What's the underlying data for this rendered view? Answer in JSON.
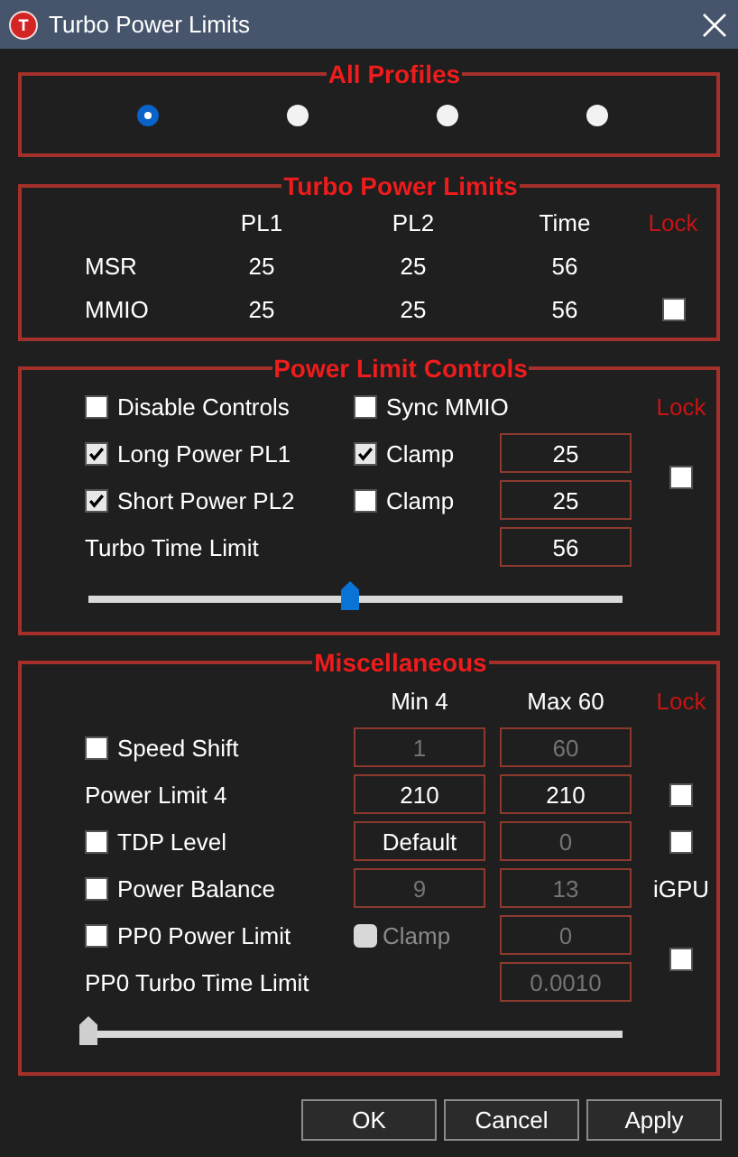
{
  "window": {
    "title": "Turbo Power Limits",
    "icon_letter": "T"
  },
  "all_profiles": {
    "title": "All Profiles",
    "profiles": [
      {
        "selected": true
      },
      {
        "selected": false
      },
      {
        "selected": false
      },
      {
        "selected": false
      }
    ]
  },
  "turbo_power_limits": {
    "title": "Turbo Power Limits",
    "columns": [
      "PL1",
      "PL2",
      "Time"
    ],
    "lock_label": "Lock",
    "rows": [
      {
        "label": "MSR",
        "values": [
          "25",
          "25",
          "56"
        ]
      },
      {
        "label": "MMIO",
        "values": [
          "25",
          "25",
          "56"
        ],
        "lock": {
          "checked": false
        }
      }
    ]
  },
  "power_limit_controls": {
    "title": "Power Limit Controls",
    "rows": [
      {
        "cells": [
          {
            "kind": "checkbox",
            "label": "Disable Controls",
            "checked": false
          },
          {
            "kind": "checkbox",
            "label": "Sync MMIO",
            "checked": false
          },
          {
            "kind": "empty"
          }
        ],
        "side": {
          "kind": "heading",
          "label": "Lock"
        }
      },
      {
        "cells": [
          {
            "kind": "checkbox",
            "label": "Long Power PL1",
            "checked": true
          },
          {
            "kind": "checkbox",
            "label": "Clamp",
            "checked": true
          },
          {
            "kind": "field",
            "value": "25",
            "disabled": false
          }
        ],
        "side": {
          "kind": "tall_checkbox",
          "checked": false
        }
      },
      {
        "cells": [
          {
            "kind": "checkbox",
            "label": "Short Power PL2",
            "checked": true
          },
          {
            "kind": "checkbox",
            "label": "Clamp",
            "checked": false
          },
          {
            "kind": "field",
            "value": "25",
            "disabled": false
          }
        ]
      },
      {
        "cells": [
          {
            "kind": "text",
            "label": "Turbo Time Limit"
          },
          {
            "kind": "empty"
          },
          {
            "kind": "field",
            "value": "56",
            "disabled": false
          }
        ]
      }
    ],
    "slider": {
      "level": 0.49,
      "disabled": false
    }
  },
  "miscellaneous": {
    "title": "Miscellaneous",
    "rows": [
      {
        "cells": [
          {
            "kind": "empty"
          },
          {
            "kind": "caption",
            "label": "Min 4"
          },
          {
            "kind": "caption",
            "label": "Max 60"
          }
        ],
        "side": {
          "kind": "heading",
          "label": "Lock"
        }
      },
      {
        "cells": [
          {
            "kind": "checkbox",
            "label": "Speed Shift",
            "checked": false
          },
          {
            "kind": "field",
            "value": "1",
            "disabled": true
          },
          {
            "kind": "field",
            "value": "60",
            "disabled": true
          }
        ]
      },
      {
        "cells": [
          {
            "kind": "text",
            "label": "Power Limit 4"
          },
          {
            "kind": "field",
            "value": "210",
            "disabled": false
          },
          {
            "kind": "field",
            "value": "210",
            "disabled": false
          }
        ],
        "side": {
          "kind": "checkbox",
          "checked": false
        }
      },
      {
        "cells": [
          {
            "kind": "checkbox",
            "label": "TDP Level",
            "checked": false
          },
          {
            "kind": "field",
            "value": "Default",
            "disabled": false
          },
          {
            "kind": "field",
            "value": "0",
            "disabled": true
          }
        ],
        "side": {
          "kind": "checkbox",
          "checked": false
        }
      },
      {
        "cells": [
          {
            "kind": "checkbox",
            "label": "Power Balance",
            "checked": false
          },
          {
            "kind": "field",
            "value": "9",
            "disabled": true
          },
          {
            "kind": "field",
            "value": "13",
            "disabled": true
          }
        ],
        "side": {
          "kind": "text",
          "label": "iGPU"
        }
      },
      {
        "cells": [
          {
            "kind": "checkbox",
            "label": "PP0 Power Limit",
            "checked": false
          },
          {
            "kind": "checkbox",
            "label": "Clamp",
            "checked": false,
            "disabled": true
          },
          {
            "kind": "field",
            "value": "0",
            "disabled": true
          }
        ],
        "side": {
          "kind": "tall_checkbox",
          "checked": false
        }
      },
      {
        "cells": [
          {
            "kind": "text",
            "label": "PP0 Turbo Time Limit"
          },
          {
            "kind": "empty"
          },
          {
            "kind": "field",
            "value": "0.0010",
            "disabled": true
          }
        ]
      }
    ],
    "slider": {
      "level": 0,
      "disabled": true
    }
  },
  "buttons": [
    "OK",
    "Cancel",
    "Apply"
  ]
}
